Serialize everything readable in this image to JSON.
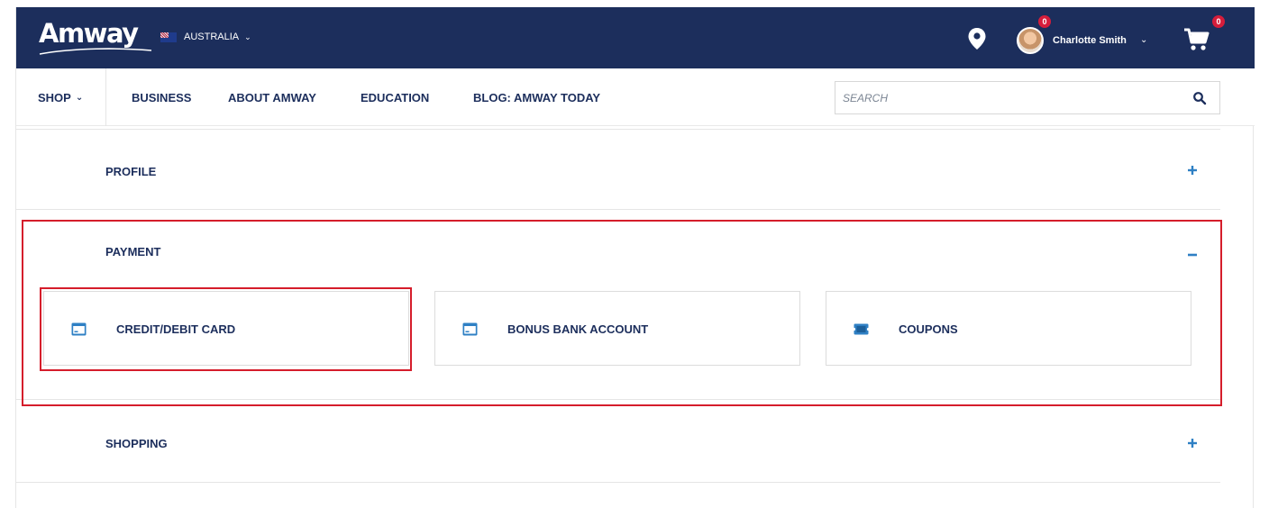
{
  "header": {
    "brand": "Amway",
    "country": "AUSTRALIA",
    "user_name": "Charlotte Smith",
    "user_badge": "0",
    "cart_badge": "0",
    "colors": {
      "bar": "#1c2e5c",
      "badge": "#d51d3b",
      "accent": "#2f80c4"
    }
  },
  "nav": {
    "shop": "SHOP",
    "items": [
      "BUSINESS",
      "ABOUT AMWAY",
      "EDUCATION",
      "BLOG: AMWAY TODAY"
    ],
    "search_placeholder": "SEARCH"
  },
  "sections": {
    "profile": {
      "title": "PROFILE",
      "state": "+"
    },
    "payment": {
      "title": "PAYMENT",
      "state": "−",
      "options": [
        {
          "label": "CREDIT/DEBIT CARD",
          "icon": "credit-card-icon"
        },
        {
          "label": "BONUS BANK ACCOUNT",
          "icon": "bank-card-icon"
        },
        {
          "label": "COUPONS",
          "icon": "coupon-icon"
        }
      ]
    },
    "shopping": {
      "title": "SHOPPING",
      "state": "+"
    }
  }
}
